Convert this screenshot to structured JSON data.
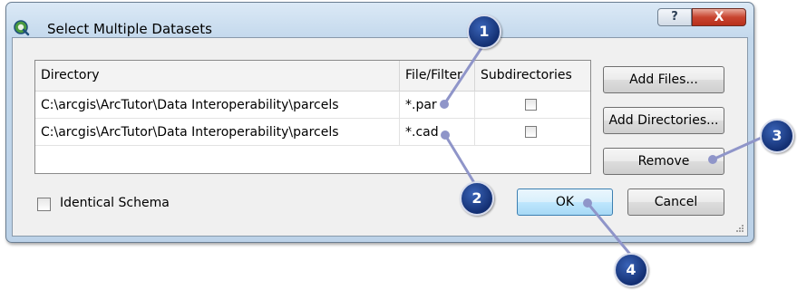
{
  "window": {
    "title": "Select Multiple Datasets",
    "help_glyph": "?",
    "close_glyph": "X"
  },
  "table": {
    "columns": [
      "Directory",
      "File/Filter",
      "Subdirectories"
    ],
    "rows": [
      {
        "directory": "C:\\arcgis\\ArcTutor\\Data Interoperability\\parcels",
        "filter": "*.par",
        "subdirectories": false
      },
      {
        "directory": "C:\\arcgis\\ArcTutor\\Data Interoperability\\parcels",
        "filter": "*.cad",
        "subdirectories": false
      }
    ]
  },
  "buttons": {
    "add_files": "Add Files...",
    "add_directories": "Add Directories...",
    "remove": "Remove",
    "ok": "OK",
    "cancel": "Cancel"
  },
  "identical_schema": {
    "label": "Identical Schema",
    "checked": false
  },
  "callouts": [
    "1",
    "2",
    "3",
    "4"
  ],
  "colors": {
    "callout": "#1f3f8a",
    "connector": "#8f95c9",
    "close_button": "#c8442f",
    "default_button": "#bee6fd"
  },
  "icons": {
    "app": "qgis-logo-icon",
    "help": "question-mark-icon",
    "close": "close-x-icon",
    "grip": "resize-grip-icon"
  }
}
